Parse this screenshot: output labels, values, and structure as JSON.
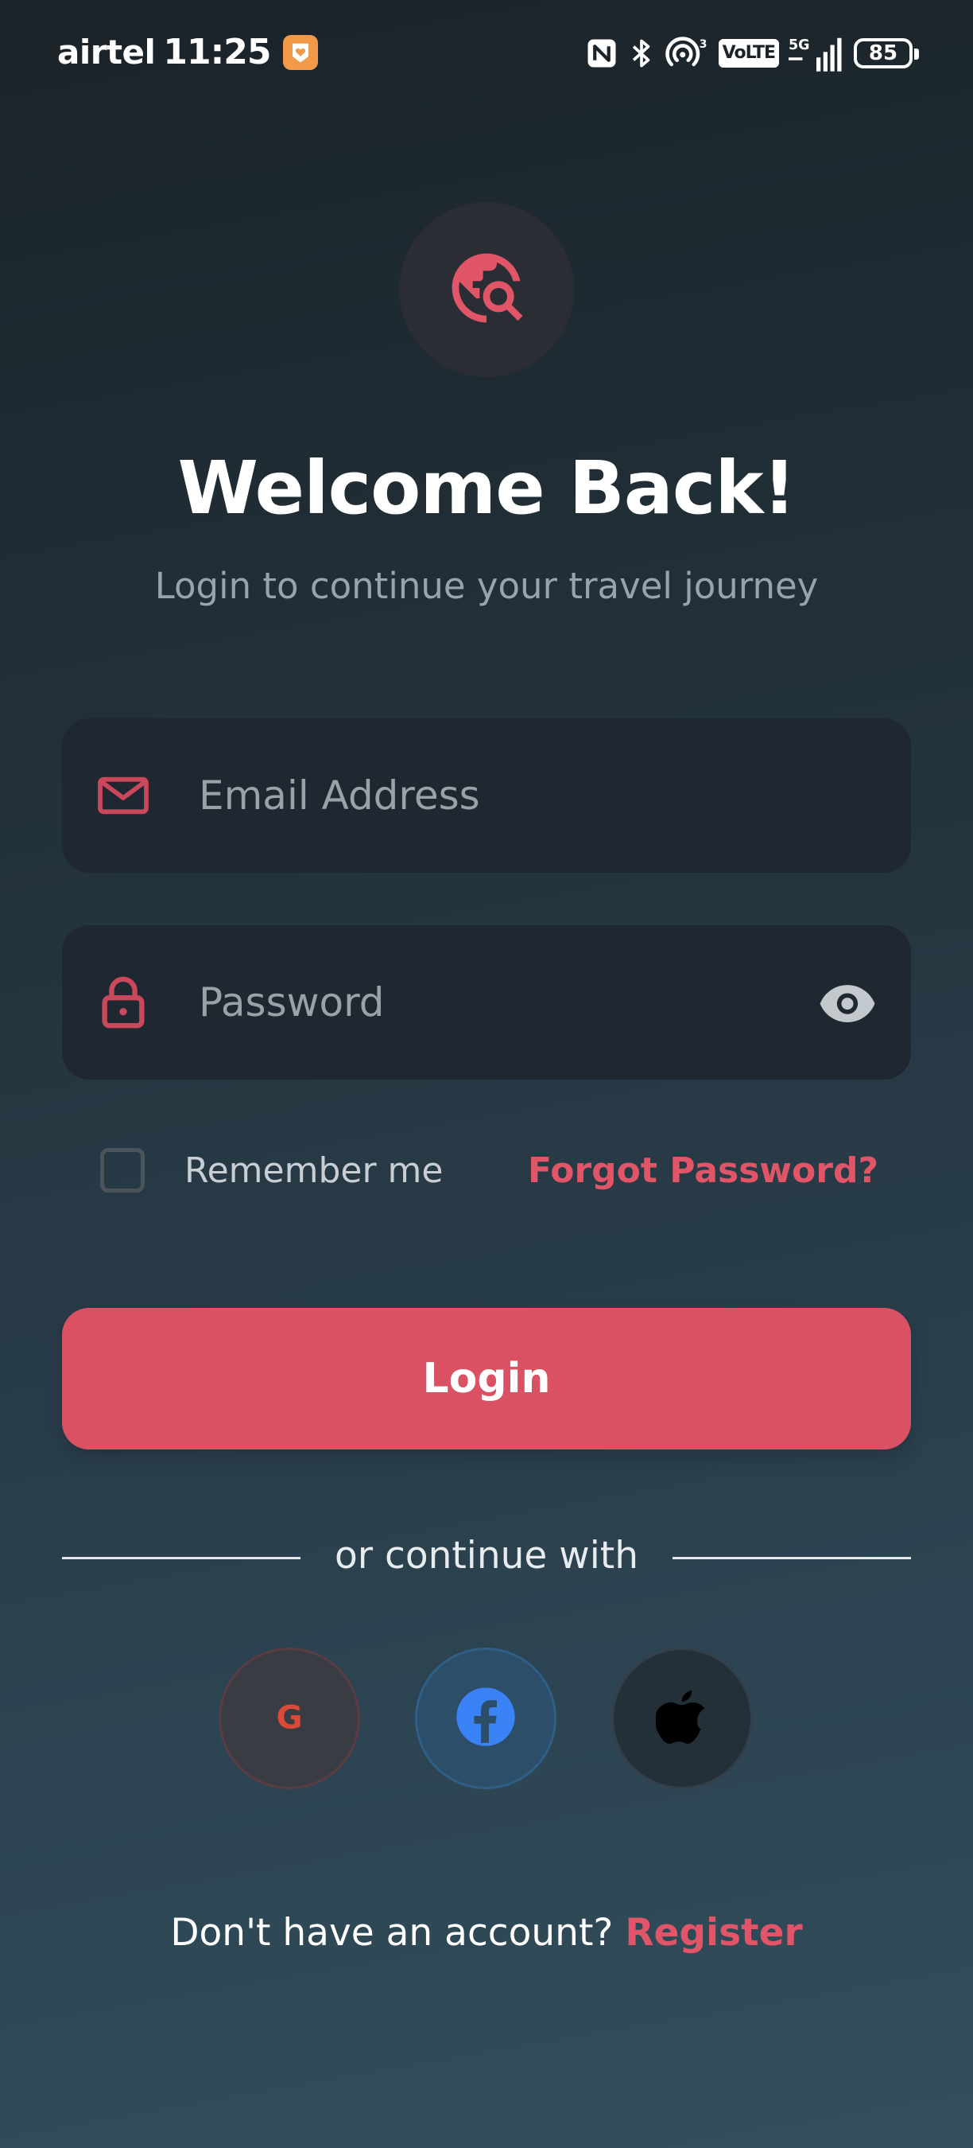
{
  "status_bar": {
    "carrier": "airtel",
    "time": "11:25",
    "network_label": "VoLTE",
    "network_gen": "5G",
    "battery": "85"
  },
  "logo": {
    "icon": "travel-explore-icon",
    "accent_color": "#e05668"
  },
  "header": {
    "title": "Welcome Back!",
    "subtitle": "Login to continue your travel journey"
  },
  "form": {
    "email": {
      "placeholder": "Email Address",
      "value": "",
      "icon": "mail-icon"
    },
    "password": {
      "placeholder": "Password",
      "value": "",
      "icon": "lock-icon",
      "toggle_icon": "eye-icon"
    },
    "remember_label": "Remember me",
    "remember_checked": false,
    "forgot_label": "Forgot Password?",
    "login_label": "Login"
  },
  "social": {
    "divider_text": "or continue with",
    "providers": [
      {
        "name": "google",
        "icon": "google-icon",
        "glyph": "G",
        "color": "#db4a39"
      },
      {
        "name": "facebook",
        "icon": "facebook-icon",
        "color": "#3b82f6"
      },
      {
        "name": "apple",
        "icon": "apple-icon",
        "color": "#000000"
      }
    ]
  },
  "footer": {
    "prompt": "Don't have an account?",
    "register_label": "Register"
  },
  "colors": {
    "accent": "#d95163",
    "field_bg": "#1f2731",
    "background_top": "#1b2329",
    "background_bottom": "#324e5d"
  }
}
